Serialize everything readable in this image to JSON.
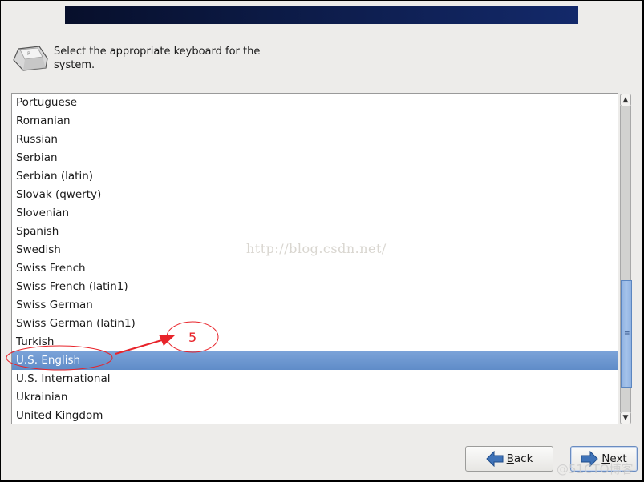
{
  "header": {
    "prompt": "Select the appropriate keyboard for the system."
  },
  "keyboard_list": {
    "items": [
      {
        "label": "Portuguese",
        "selected": false
      },
      {
        "label": "Romanian",
        "selected": false
      },
      {
        "label": "Russian",
        "selected": false
      },
      {
        "label": "Serbian",
        "selected": false
      },
      {
        "label": "Serbian (latin)",
        "selected": false
      },
      {
        "label": "Slovak (qwerty)",
        "selected": false
      },
      {
        "label": "Slovenian",
        "selected": false
      },
      {
        "label": "Spanish",
        "selected": false
      },
      {
        "label": "Swedish",
        "selected": false
      },
      {
        "label": "Swiss French",
        "selected": false
      },
      {
        "label": "Swiss French (latin1)",
        "selected": false
      },
      {
        "label": "Swiss German",
        "selected": false
      },
      {
        "label": "Swiss German (latin1)",
        "selected": false
      },
      {
        "label": "Turkish",
        "selected": false
      },
      {
        "label": "U.S. English",
        "selected": true
      },
      {
        "label": "U.S. International",
        "selected": false
      },
      {
        "label": "Ukrainian",
        "selected": false
      },
      {
        "label": "United Kingdom",
        "selected": false
      }
    ],
    "selected_value": "U.S. English",
    "scroll_position": 0.88
  },
  "buttons": {
    "back_mnemonic": "B",
    "back_rest": "ack",
    "next_mnemonic": "N",
    "next_rest": "ext"
  },
  "annotation": {
    "step_number": "5",
    "color": "#e8232a"
  },
  "watermarks": {
    "url": "http://blog.csdn.net/",
    "site": "@51CTO博客"
  },
  "colors": {
    "selection": "#6b96cf",
    "banner": "#0c1a45",
    "background": "#edecea"
  }
}
